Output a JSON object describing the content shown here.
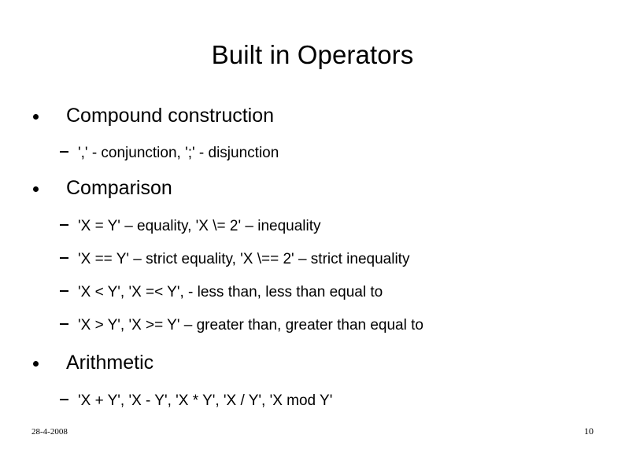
{
  "slide": {
    "title": "Built in Operators",
    "sections": [
      {
        "heading": "Compound construction",
        "items": [
          "',' - conjunction, ';' - disjunction"
        ]
      },
      {
        "heading": "Comparison",
        "items": [
          "'X = Y' – equality, 'X \\= 2' – inequality",
          "'X == Y' – strict equality, 'X \\== 2' – strict inequality",
          "'X < Y', 'X =< Y', - less than, less than equal to",
          "'X > Y', 'X >= Y' – greater than, greater than equal to"
        ]
      },
      {
        "heading": "Arithmetic",
        "items": [
          "'X + Y', 'X - Y', 'X * Y', 'X / Y', 'X mod Y'"
        ]
      }
    ],
    "footer": {
      "date": "28-4-2008",
      "page_number": "10"
    },
    "colors": {
      "background": "#ffffff",
      "text": "#000000"
    }
  }
}
